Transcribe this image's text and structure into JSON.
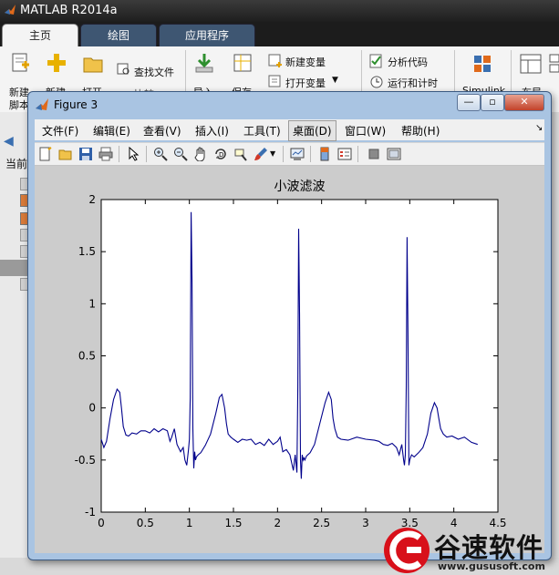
{
  "matlab": {
    "title": "MATLAB R2014a",
    "tabs": [
      "主页",
      "绘图",
      "应用程序"
    ],
    "ribbon": {
      "new_script": [
        "新建",
        "脚本"
      ],
      "new": "新建",
      "open": "打开",
      "find_files": "查找文件",
      "compare": "比较",
      "import": "导入",
      "save": "保存",
      "new_variable": "新建变量",
      "open_variable": "打开变量",
      "analyze_code": "分析代码",
      "run_and_time": "运行和计时",
      "simulink": "Simulink",
      "layout": "布局"
    },
    "left_panel_label": "当前"
  },
  "figure": {
    "title": "Figure 3",
    "menus": [
      "文件(F)",
      "编辑(E)",
      "查看(V)",
      "插入(I)",
      "工具(T)",
      "桌面(D)",
      "窗口(W)",
      "帮助(H)"
    ],
    "active_menu": "桌面(D)"
  },
  "watermark": {
    "name": "谷速软件",
    "url": "www.gususoft.com"
  },
  "chart_data": {
    "type": "line",
    "title": "小波滤波",
    "xlim": [
      0,
      4.5
    ],
    "ylim": [
      -1,
      2
    ],
    "xticks": [
      0,
      0.5,
      1,
      1.5,
      2,
      2.5,
      3,
      3.5,
      4,
      4.5
    ],
    "xtick_labels": [
      "0",
      "0.5",
      "1",
      "1.5",
      "2",
      "2.5",
      "3",
      "3.5",
      "4",
      "4.5"
    ],
    "yticks": [
      -1,
      -0.5,
      0,
      0.5,
      1,
      1.5,
      2
    ],
    "ytick_labels": [
      "-1",
      "-0.5",
      "0",
      "0.5",
      "1",
      "1.5",
      "2"
    ],
    "grid": false,
    "line_color": "#00008b",
    "series": [
      {
        "x": [
          0.0,
          0.03,
          0.06,
          0.1,
          0.14,
          0.18,
          0.21,
          0.23,
          0.25,
          0.28,
          0.31,
          0.35,
          0.4,
          0.45,
          0.5,
          0.55,
          0.6,
          0.65,
          0.7,
          0.75,
          0.78,
          0.8,
          0.83,
          0.86,
          0.9,
          0.93,
          0.95,
          0.97,
          0.99,
          1.0,
          1.01,
          1.02,
          1.03,
          1.04,
          1.05,
          1.06,
          1.07,
          1.08,
          1.1,
          1.13,
          1.18,
          1.24,
          1.3,
          1.34,
          1.37,
          1.4,
          1.42,
          1.44,
          1.47,
          1.5,
          1.55,
          1.6,
          1.65,
          1.7,
          1.75,
          1.8,
          1.85,
          1.9,
          1.95,
          2.0,
          2.03,
          2.06,
          2.1,
          2.14,
          2.18,
          2.2,
          2.22,
          2.23,
          2.24,
          2.25,
          2.26,
          2.27,
          2.28,
          2.29,
          2.3,
          2.31,
          2.33,
          2.37,
          2.42,
          2.48,
          2.54,
          2.58,
          2.61,
          2.63,
          2.65,
          2.68,
          2.72,
          2.8,
          2.9,
          3.0,
          3.1,
          3.15,
          3.2,
          3.25,
          3.3,
          3.35,
          3.38,
          3.41,
          3.43,
          3.44,
          3.45,
          3.46,
          3.47,
          3.48,
          3.49,
          3.5,
          3.52,
          3.55,
          3.6,
          3.65,
          3.7,
          3.74,
          3.78,
          3.81,
          3.83,
          3.85,
          3.88,
          3.92,
          3.98,
          4.05,
          4.12,
          4.2,
          4.27
        ],
        "y": [
          -0.3,
          -0.38,
          -0.32,
          -0.1,
          0.08,
          0.18,
          0.15,
          0.0,
          -0.18,
          -0.26,
          -0.27,
          -0.24,
          -0.25,
          -0.22,
          -0.22,
          -0.24,
          -0.2,
          -0.23,
          -0.2,
          -0.22,
          -0.32,
          -0.28,
          -0.2,
          -0.35,
          -0.42,
          -0.38,
          -0.5,
          -0.55,
          -0.4,
          -0.3,
          0.1,
          1.88,
          1.2,
          -0.2,
          -0.58,
          -0.42,
          -0.5,
          -0.47,
          -0.45,
          -0.43,
          -0.36,
          -0.25,
          -0.05,
          0.1,
          0.13,
          0.0,
          -0.15,
          -0.25,
          -0.28,
          -0.3,
          -0.33,
          -0.3,
          -0.31,
          -0.3,
          -0.35,
          -0.33,
          -0.36,
          -0.3,
          -0.35,
          -0.32,
          -0.28,
          -0.42,
          -0.4,
          -0.45,
          -0.6,
          -0.45,
          -0.62,
          0.2,
          1.72,
          0.9,
          -0.5,
          -0.68,
          -0.45,
          -0.5,
          -0.48,
          -0.5,
          -0.46,
          -0.43,
          -0.35,
          -0.15,
          0.05,
          0.15,
          0.08,
          -0.1,
          -0.2,
          -0.28,
          -0.3,
          -0.31,
          -0.28,
          -0.3,
          -0.31,
          -0.32,
          -0.35,
          -0.36,
          -0.34,
          -0.38,
          -0.45,
          -0.35,
          -0.5,
          -0.55,
          -0.45,
          0.2,
          1.64,
          0.7,
          -0.55,
          -0.5,
          -0.45,
          -0.47,
          -0.43,
          -0.38,
          -0.25,
          -0.05,
          0.05,
          0.0,
          -0.1,
          -0.2,
          -0.25,
          -0.28,
          -0.27,
          -0.3,
          -0.28,
          -0.33,
          -0.35
        ]
      }
    ]
  }
}
